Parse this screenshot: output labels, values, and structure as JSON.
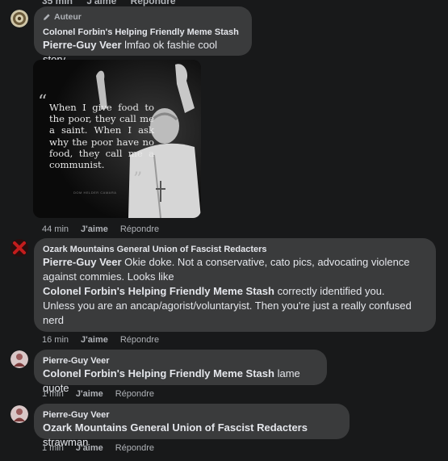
{
  "top_actions": {
    "time": "35 min",
    "like": "J'aime",
    "reply": "Répondre"
  },
  "comments": [
    {
      "badge": "Auteur",
      "author": "Colonel Forbin's Helping Friendly Meme Stash",
      "mention": "Pierre-Guy Veer",
      "text": " lmfao ok fashie cool story.",
      "time": "44 min",
      "like": "J'aime",
      "reply": "Répondre",
      "image_quote": "When I give food to the poor, they call me a saint. When I ask why the poor have no food, they call me a communist.",
      "image_credit": "DOM HELDER CAMARA"
    },
    {
      "author": "Ozark Mountains General Union of Fascist Redacters",
      "mention": "Pierre-Guy Veer",
      "text": " Okie doke. Not a conservative, cato pics, advocating violence against commies. Looks like",
      "mention2": "Colonel Forbin's Helping Friendly Meme Stash",
      "text2": " correctly identified you.",
      "text3": "Unless you are an ancap/agorist/voluntaryist. Then you're just a really confused nerd",
      "time": "16 min",
      "like": "J'aime",
      "reply": "Répondre"
    },
    {
      "author": "Pierre-Guy Veer",
      "mention": "Colonel Forbin's Helping Friendly Meme Stash",
      "text": " lame quote",
      "time": "1 min",
      "like": "J'aime",
      "reply": "Répondre"
    },
    {
      "author": "Pierre-Guy Veer",
      "mention": "Ozark Mountains General Union of Fascist Redacters",
      "text": " strawman",
      "time": "1 min",
      "like": "J'aime",
      "reply": "Répondre"
    }
  ],
  "colors": {
    "background": "#18191a",
    "bubble": "#3a3b3c",
    "text": "#e4e6eb",
    "secondary": "#b0b3b8"
  }
}
